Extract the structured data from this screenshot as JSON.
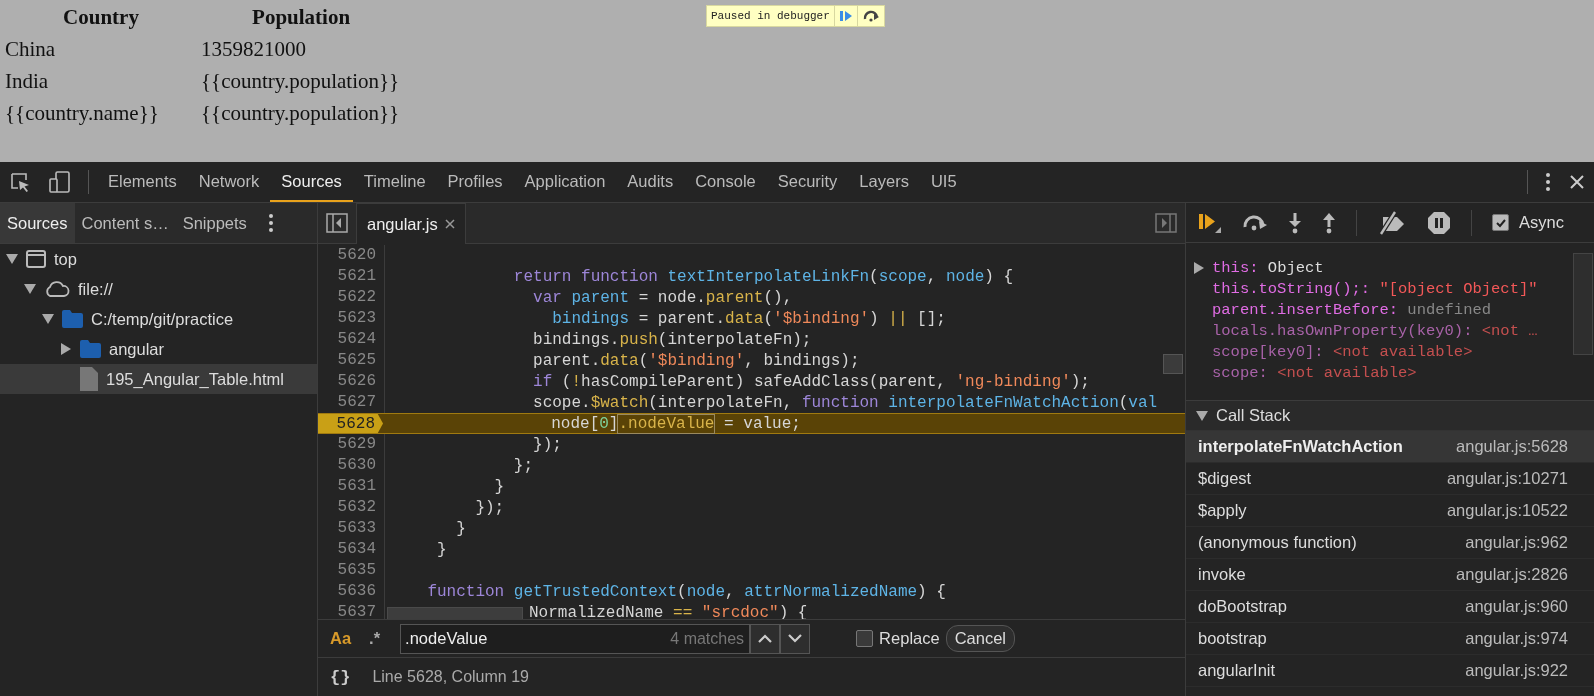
{
  "page": {
    "table": {
      "columns": [
        "Country",
        "Population"
      ],
      "rows": [
        [
          "China",
          "1359821000"
        ],
        [
          "India",
          "{{country.population}}"
        ],
        [
          "{{country.name}}",
          "{{country.population}}"
        ]
      ]
    },
    "paused_overlay": {
      "message": "Paused in debugger"
    }
  },
  "devtools": {
    "tabs": [
      {
        "label": "Elements",
        "selected": false
      },
      {
        "label": "Network",
        "selected": false
      },
      {
        "label": "Sources",
        "selected": true
      },
      {
        "label": "Timeline",
        "selected": false
      },
      {
        "label": "Profiles",
        "selected": false
      },
      {
        "label": "Application",
        "selected": false
      },
      {
        "label": "Audits",
        "selected": false
      },
      {
        "label": "Console",
        "selected": false
      },
      {
        "label": "Security",
        "selected": false
      },
      {
        "label": "Layers",
        "selected": false
      },
      {
        "label": "UI5",
        "selected": false
      }
    ]
  },
  "navigator": {
    "tabs": [
      {
        "label": "Sources",
        "selected": true
      },
      {
        "label": "Content s…",
        "selected": false
      },
      {
        "label": "Snippets",
        "selected": false
      }
    ],
    "tree": [
      {
        "label": "top",
        "kind": "frame",
        "expanded": true,
        "selected": false,
        "children": [
          {
            "label": "file://",
            "kind": "domain",
            "expanded": true,
            "selected": false,
            "children": [
              {
                "label": "C:/temp/git/practice",
                "kind": "folder",
                "expanded": true,
                "selected": false,
                "children": [
                  {
                    "label": "angular",
                    "kind": "folder",
                    "expanded": false,
                    "selected": false
                  },
                  {
                    "label": "195_Angular_Table.html",
                    "kind": "file",
                    "selected": true
                  }
                ]
              }
            ]
          }
        ]
      }
    ]
  },
  "editor": {
    "tabs": [
      {
        "label": "angular.js",
        "selected": true
      }
    ],
    "lines": [
      {
        "number": "5620",
        "current": false
      },
      {
        "number": "5621",
        "current": false,
        "tokens": [
          {
            "text": "             return",
            "kind": "kw"
          },
          {
            "text": " function",
            "kind": "kw"
          },
          {
            "text": " textInterpolateLinkFn",
            "kind": "def"
          },
          {
            "text": "(",
            "kind": "plain"
          },
          {
            "text": "scope",
            "kind": "def"
          },
          {
            "text": ", ",
            "kind": "plain"
          },
          {
            "text": "node",
            "kind": "def"
          },
          {
            "text": ") {",
            "kind": "plain"
          }
        ]
      },
      {
        "number": "5622",
        "current": false,
        "tokens": [
          {
            "text": "               var",
            "kind": "kw"
          },
          {
            "text": " parent",
            "kind": "def"
          },
          {
            "text": " = node.",
            "kind": "plain"
          },
          {
            "text": "parent",
            "kind": "prop"
          },
          {
            "text": "(),",
            "kind": "plain"
          }
        ]
      },
      {
        "number": "5623",
        "current": false,
        "tokens": [
          {
            "text": "                 bindings",
            "kind": "def"
          },
          {
            "text": " = parent.",
            "kind": "plain"
          },
          {
            "text": "data",
            "kind": "prop"
          },
          {
            "text": "(",
            "kind": "plain"
          },
          {
            "text": "'$binding'",
            "kind": "str"
          },
          {
            "text": ") ",
            "kind": "plain"
          },
          {
            "text": "||",
            "kind": "prop"
          },
          {
            "text": " [];",
            "kind": "plain"
          }
        ]
      },
      {
        "number": "5624",
        "current": false,
        "tokens": [
          {
            "text": "               bindings.",
            "kind": "plain"
          },
          {
            "text": "push",
            "kind": "prop"
          },
          {
            "text": "(interpolateFn);",
            "kind": "plain"
          }
        ]
      },
      {
        "number": "5625",
        "current": false,
        "tokens": [
          {
            "text": "               parent.",
            "kind": "plain"
          },
          {
            "text": "data",
            "kind": "prop"
          },
          {
            "text": "(",
            "kind": "plain"
          },
          {
            "text": "'$binding'",
            "kind": "str"
          },
          {
            "text": ", bindings);",
            "kind": "plain"
          }
        ]
      },
      {
        "number": "5626",
        "current": false,
        "tokens": [
          {
            "text": "               if",
            "kind": "kw"
          },
          {
            "text": " (",
            "kind": "plain"
          },
          {
            "text": "!",
            "kind": "prop"
          },
          {
            "text": "hasCompileParent) safeAddClass(parent, ",
            "kind": "plain"
          },
          {
            "text": "'ng-binding'",
            "kind": "str"
          },
          {
            "text": ");",
            "kind": "plain"
          }
        ]
      },
      {
        "number": "5627",
        "current": false,
        "tokens": [
          {
            "text": "               scope.",
            "kind": "plain"
          },
          {
            "text": "$watch",
            "kind": "prop"
          },
          {
            "text": "(interpolateFn, ",
            "kind": "plain"
          },
          {
            "text": "function",
            "kind": "kw"
          },
          {
            "text": " interpolateFnWatchAction",
            "kind": "def"
          },
          {
            "text": "(",
            "kind": "plain"
          },
          {
            "text": "val",
            "kind": "def"
          }
        ]
      },
      {
        "number": "5628",
        "current": true,
        "tokens": [
          {
            "text": "                 node[",
            "kind": "plain"
          },
          {
            "text": "0",
            "kind": "num"
          },
          {
            "text": "]",
            "kind": "plain"
          },
          {
            "text": ".nodeValue",
            "kind": "match"
          },
          {
            "text": " = value;",
            "kind": "plain"
          }
        ]
      },
      {
        "number": "5629",
        "current": false,
        "tokens": [
          {
            "text": "               });",
            "kind": "plain"
          }
        ]
      },
      {
        "number": "5630",
        "current": false,
        "tokens": [
          {
            "text": "             };",
            "kind": "plain"
          }
        ]
      },
      {
        "number": "5631",
        "current": false,
        "tokens": [
          {
            "text": "           }",
            "kind": "plain"
          }
        ]
      },
      {
        "number": "5632",
        "current": false,
        "tokens": [
          {
            "text": "         });",
            "kind": "plain"
          }
        ]
      },
      {
        "number": "5633",
        "current": false,
        "tokens": [
          {
            "text": "       }",
            "kind": "plain"
          }
        ]
      },
      {
        "number": "5634",
        "current": false,
        "tokens": [
          {
            "text": "     }",
            "kind": "plain"
          }
        ]
      },
      {
        "number": "5635",
        "current": false
      },
      {
        "number": "5636",
        "current": false,
        "tokens": [
          {
            "text": "    function",
            "kind": "kw"
          },
          {
            "text": " getTrustedContext",
            "kind": "def"
          },
          {
            "text": "(",
            "kind": "plain"
          },
          {
            "text": "node",
            "kind": "def"
          },
          {
            "text": ", ",
            "kind": "plain"
          },
          {
            "text": "attrNormalizedName",
            "kind": "def"
          },
          {
            "text": ") {",
            "kind": "plain"
          }
        ]
      },
      {
        "number": "5637",
        "current": false,
        "covered": true,
        "tokens": [
          {
            "text": "NormalizedName ",
            "kind": "plain"
          },
          {
            "text": "==",
            "kind": "prop"
          },
          {
            "text": " \"srcdoc\"",
            "kind": "str"
          },
          {
            "text": ") {",
            "kind": "plain"
          }
        ]
      }
    ],
    "search": {
      "match_case": {
        "label": "Aa",
        "on": true
      },
      "regex": {
        "label": ".*",
        "on": false
      },
      "value": ".nodeValue",
      "count": "4 matches",
      "replace": {
        "label": "Replace",
        "checked": false
      },
      "cancel": "Cancel"
    },
    "status": {
      "format_button": "{}",
      "position": "Line 5628, Column 19"
    }
  },
  "debugger": {
    "async": {
      "label": "Async",
      "checked": true
    },
    "scope": [
      {
        "name": "this:",
        "value": "Object",
        "kind": "object",
        "expandable": true,
        "dim": false
      },
      {
        "name": "this.toString();:",
        "value": "\"[object Object]\"",
        "kind": "string",
        "expandable": false,
        "dim": false
      },
      {
        "name": "parent.insertBefore:",
        "value": "undefined",
        "kind": "undefined",
        "expandable": false,
        "dim": false
      },
      {
        "name": "locals.hasOwnProperty(key0):",
        "value": "<not …",
        "kind": "unavailable",
        "expandable": false,
        "dim": true
      },
      {
        "name": "scope[key0]:",
        "value": "<not available>",
        "kind": "unavailable",
        "expandable": false,
        "dim": true
      },
      {
        "name": "scope:",
        "value": "<not available>",
        "kind": "unavailable",
        "expandable": false,
        "dim": true
      }
    ],
    "call_stack": {
      "title": "Call Stack",
      "expanded": true,
      "frames": [
        {
          "function": "interpolateFnWatchAction",
          "location": "angular.js:5628",
          "selected": true
        },
        {
          "function": "$digest",
          "location": "angular.js:10271",
          "selected": false
        },
        {
          "function": "$apply",
          "location": "angular.js:10522",
          "selected": false
        },
        {
          "function": "(anonymous function)",
          "location": "angular.js:962",
          "selected": false
        },
        {
          "function": "invoke",
          "location": "angular.js:2826",
          "selected": false
        },
        {
          "function": "doBootstrap",
          "location": "angular.js:960",
          "selected": false
        },
        {
          "function": "bootstrap",
          "location": "angular.js:974",
          "selected": false
        },
        {
          "function": "angularInit",
          "location": "angular.js:922",
          "selected": false
        }
      ]
    }
  }
}
